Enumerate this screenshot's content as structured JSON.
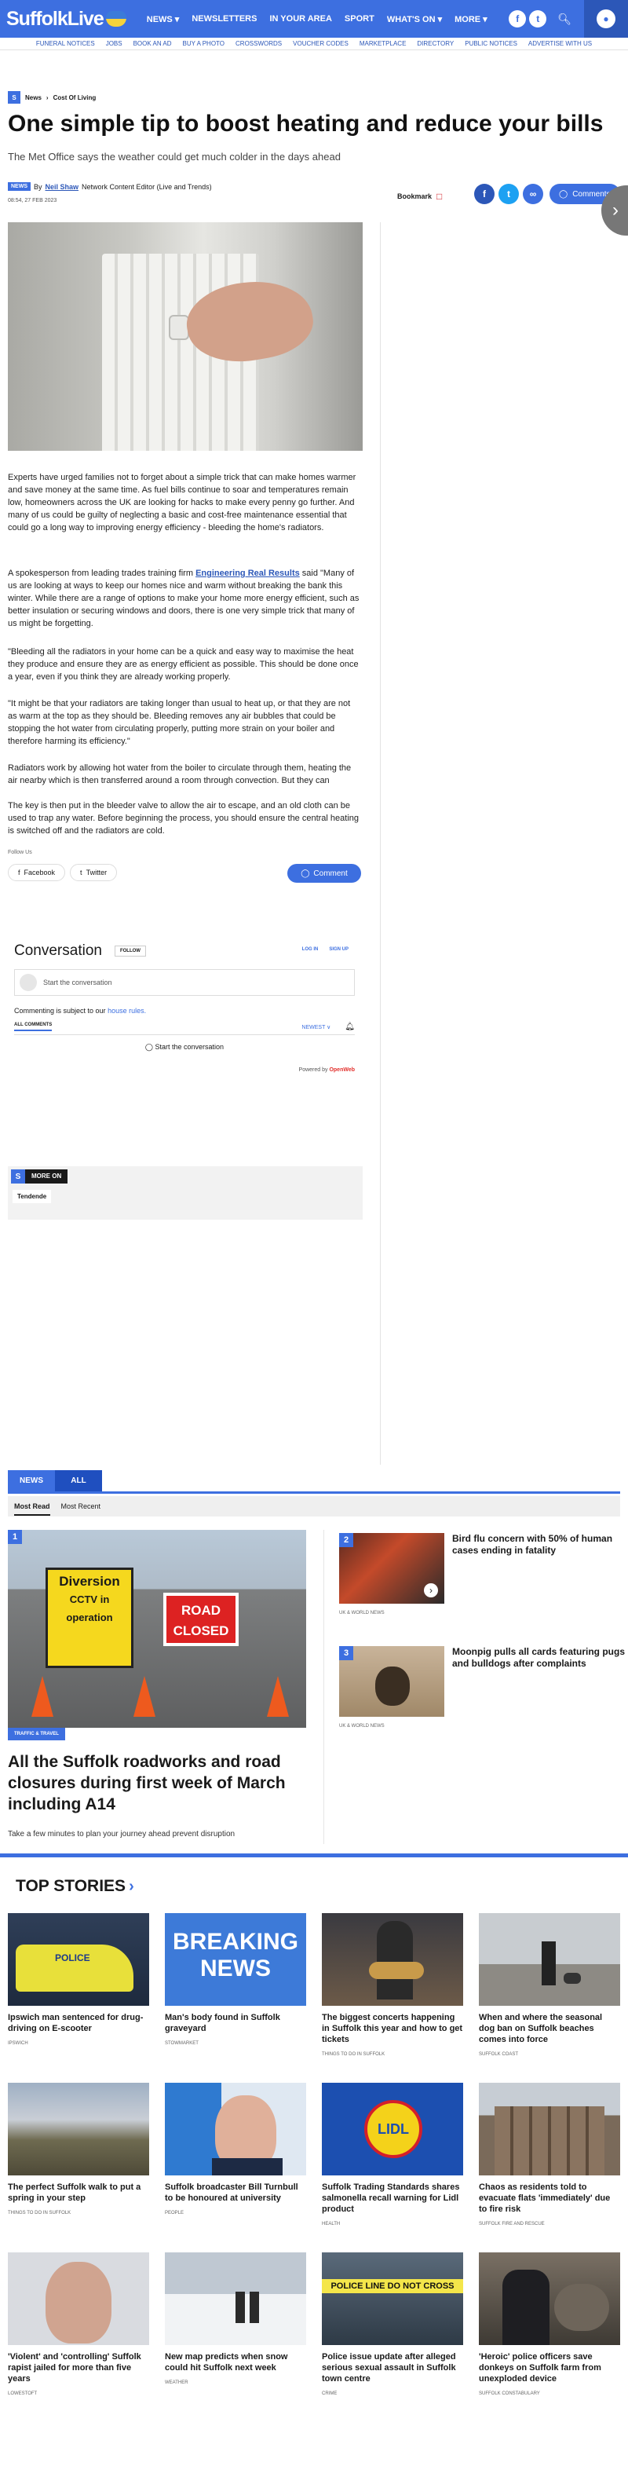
{
  "header": {
    "logo": "SuffolkLive",
    "nav": [
      "NEWS ▾",
      "NEWSLETTERS",
      "IN YOUR AREA",
      "SPORT",
      "WHAT'S ON ▾",
      "MORE ▾"
    ],
    "subnav": [
      "FUNERAL NOTICES",
      "JOBS",
      "BOOK AN AD",
      "BUY A PHOTO",
      "CROSSWORDS",
      "VOUCHER CODES",
      "MARKETPLACE",
      "DIRECTORY",
      "PUBLIC NOTICES",
      "ADVERTISE WITH US"
    ]
  },
  "breadcrumb": {
    "badge": "S",
    "items": [
      "News",
      "Cost Of Living"
    ]
  },
  "article": {
    "title": "One simple tip to boost heating and reduce your bills",
    "standfirst": "The Met Office says the weather could get much colder in the days ahead",
    "tag": "NEWS",
    "by": "By",
    "author": "Neil Shaw",
    "role": "Network Content Editor (Live and Trends)",
    "date": "08:54, 27 FEB 2023",
    "bookmark": "Bookmark",
    "comments": "Comments",
    "p1": "Experts have urged families not to forget about a simple trick that can make homes warmer and save money at the same time. As fuel bills continue to soar and temperatures remain low, homeowners across the UK are looking for hacks to make every penny go further. And many of us could be guilty of neglecting a basic and cost-free maintenance essential that could go a long way to improving energy efficiency - bleeding the home's radiators.",
    "p2a": "A spokesperson from leading trades training firm",
    "p2link": "Engineering Real Results",
    "p2b": "said \"Many of us are looking at ways to keep our homes nice and warm without breaking the bank this winter. While there are a range of options to make your home more energy efficient, such as better insulation or securing windows and doors, there is one very simple trick that many of us might be forgetting.",
    "p3": "\"Bleeding all the radiators in your home can be a quick and easy way to maximise the heat they produce and ensure they are as energy efficient as possible. This should be done once a year, even if you think they are already working properly.",
    "p4": "\"It might be that your radiators are taking longer than usual to heat up, or that they are not as warm at the top as they should be. Bleeding removes any air bubbles that could be stopping the hot water from circulating properly, putting more strain on your boiler and therefore harming its efficiency.\"",
    "p5": "Radiators work by allowing hot water from the boiler to circulate through them, heating the air nearby which is then transferred around a room through convection. But they can",
    "p6": "The key is then put in the bleeder valve to allow the air to escape, and an old cloth can be used to trap any water. Before beginning the process, you should ensure the central heating is switched off and the radiators are cold.",
    "follow": "Follow Us",
    "facebook": "Facebook",
    "twitter": "Twitter",
    "comment": "Comment"
  },
  "conversation": {
    "title": "Conversation",
    "follow": "FOLLOW",
    "login": "LOG IN",
    "signup": "SIGN UP",
    "placeholder": "Start the conversation",
    "subj": "Commenting is subject to our",
    "rules": "house rules.",
    "all": "ALL COMMENTS",
    "newest": "NEWEST ∨",
    "start": "Start the conversation",
    "powered": "Powered by",
    "brand": "OpenWeb"
  },
  "more": {
    "badge": "S",
    "label": "MORE ON",
    "tag": "Tendende"
  },
  "tabs": {
    "news": "NEWS",
    "all": "ALL",
    "mostread": "Most Read",
    "mostrecent": "Most Recent"
  },
  "lead": {
    "num": "1",
    "diversion": "Diversion",
    "cctv": "CCTV in operation",
    "road": "ROAD CLOSED",
    "tag": "TRAFFIC & TRAVEL",
    "title": "All the Suffolk roadworks and road closures during first week of March including A14",
    "desc": "Take a few minutes to plan your journey ahead prevent disruption"
  },
  "mostread": [
    {
      "num": "2",
      "title": "Bird flu concern with 50% of human cases ending in fatality",
      "cat": "UK & WORLD NEWS"
    },
    {
      "num": "3",
      "title": "Moonpig pulls all cards featuring pugs and bulldogs after complaints",
      "cat": "UK & WORLD NEWS"
    }
  ],
  "topstories": {
    "title": "TOP STORIES",
    "police": "POLICE",
    "breaking": "BREAKING NEWS",
    "lidl": "LIDL",
    "police_line": "POLICE LINE DO NOT CROSS",
    "items": [
      {
        "title": "Ipswich man sentenced for drug-driving on E-scooter",
        "cat": "IPSWICH"
      },
      {
        "title": "Man's body found in Suffolk graveyard",
        "cat": "STOWMARKET"
      },
      {
        "title": "The biggest concerts happening in Suffolk this year and how to get tickets",
        "cat": "THINGS TO DO IN SUFFOLK"
      },
      {
        "title": "When and where the seasonal dog ban on Suffolk beaches comes into force",
        "cat": "SUFFOLK COAST"
      },
      {
        "title": "The perfect Suffolk walk to put a spring in your step",
        "cat": "THINGS TO DO IN SUFFOLK"
      },
      {
        "title": "Suffolk broadcaster Bill Turnbull to be honoured at university",
        "cat": "PEOPLE"
      },
      {
        "title": "Suffolk Trading Standards shares salmonella recall warning for Lidl product",
        "cat": "HEALTH"
      },
      {
        "title": "Chaos as residents told to evacuate flats 'immediately' due to fire risk",
        "cat": "SUFFOLK FIRE AND RESCUE"
      },
      {
        "title": "'Violent' and 'controlling' Suffolk rapist jailed for more than five years",
        "cat": "LOWESTOFT"
      },
      {
        "title": "New map predicts when snow could hit Suffolk next week",
        "cat": "WEATHER"
      },
      {
        "title": "Police issue update after alleged serious sexual assault in Suffolk town centre",
        "cat": "CRIME"
      },
      {
        "title": "'Heroic' police officers save donkeys on Suffolk farm from unexploded device",
        "cat": "SUFFOLK CONSTABULARY"
      }
    ]
  }
}
